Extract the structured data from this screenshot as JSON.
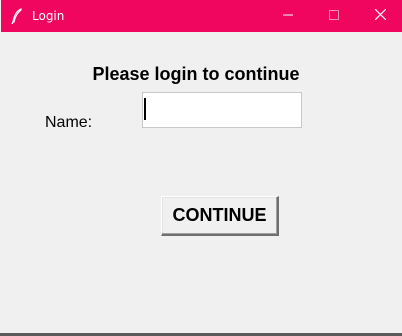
{
  "window": {
    "title": "Login",
    "accent_color": "#f0055f",
    "background_color": "#f0f0f0"
  },
  "titlebar": {
    "icons": [
      "feather-icon",
      "minimize-icon",
      "maximize-icon",
      "close-icon"
    ]
  },
  "form": {
    "heading": "Please login to continue",
    "name_label": "Name:",
    "name_value": "",
    "continue_label": "CONTINUE"
  }
}
